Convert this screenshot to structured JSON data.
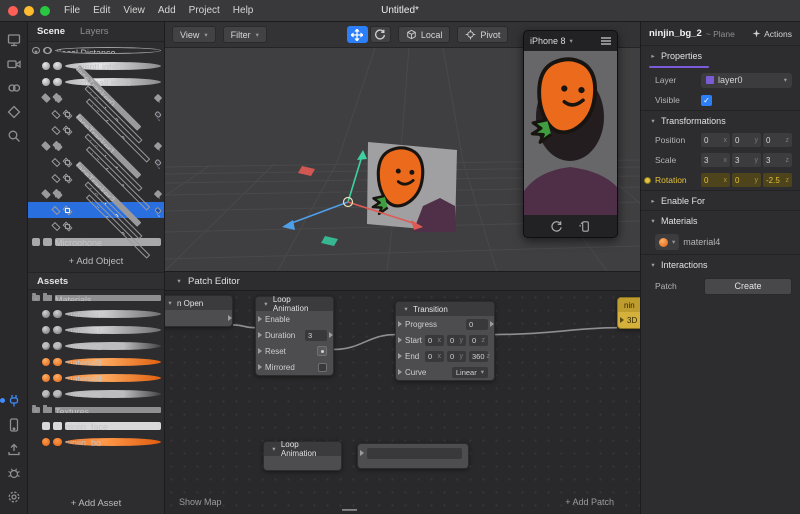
{
  "titlebar": {
    "title": "Untitled*",
    "menus": [
      "File",
      "Edit",
      "View",
      "Add",
      "Project",
      "Help"
    ]
  },
  "left_toolbar": {
    "icons": [
      "display-icon",
      "camera-icon",
      "orbit-icon",
      "mesh-icon",
      "search-icon",
      "plug-icon",
      "device-icon",
      "upload-icon",
      "bug-icon",
      "gear-icon"
    ]
  },
  "scene": {
    "tabs": {
      "scene": "Scene",
      "layers": "Layers"
    },
    "items": [
      {
        "label": "Focal Distance",
        "depth": 0,
        "icon": "focal",
        "expander": true
      },
      {
        "label": "ambientLight0",
        "depth": 1,
        "icon": "light"
      },
      {
        "label": "directionalLight0",
        "depth": 1,
        "icon": "light"
      },
      {
        "label": "faceTracker0",
        "depth": 1,
        "icon": "tracker",
        "expander": true,
        "badge": true
      },
      {
        "label": "ninjin_bg_0",
        "depth": 2,
        "icon": "plane",
        "badge": true
      },
      {
        "label": "ninjin_face_0",
        "depth": 2,
        "icon": "plane"
      },
      {
        "label": "faceTracker1",
        "depth": 1,
        "icon": "tracker",
        "expander": true,
        "badge": true
      },
      {
        "label": "ninjin_bg_1",
        "depth": 2,
        "icon": "plane",
        "badge": true
      },
      {
        "label": "ninjin_face_1",
        "depth": 2,
        "icon": "plane"
      },
      {
        "label": "faceTracker2",
        "depth": 1,
        "icon": "tracker",
        "expander": true,
        "badge": true
      },
      {
        "label": "ninjin_bg_2",
        "depth": 2,
        "icon": "plane",
        "badge": true,
        "selected": true
      },
      {
        "label": "ninjin_face_2",
        "depth": 2,
        "icon": "plane"
      },
      {
        "label": "Microphone",
        "depth": 0,
        "icon": "mic"
      }
    ],
    "add_button": "+ Add Object"
  },
  "assets": {
    "title": "Assets",
    "items": [
      {
        "label": "Materials",
        "depth": 0,
        "icon": "folder",
        "expander": true
      },
      {
        "label": "material0",
        "depth": 1,
        "icon": "sphere-gray"
      },
      {
        "label": "material1",
        "depth": 1,
        "icon": "sphere-gray"
      },
      {
        "label": "material2",
        "depth": 1,
        "icon": "sphere-half"
      },
      {
        "label": "material3",
        "depth": 1,
        "icon": "sphere-orange"
      },
      {
        "label": "material4",
        "depth": 1,
        "icon": "sphere-orange"
      },
      {
        "label": "material5",
        "depth": 1,
        "icon": "sphere-half"
      },
      {
        "label": "Textures",
        "depth": 0,
        "icon": "folder",
        "expander": true
      },
      {
        "label": "ninjin_face",
        "depth": 1,
        "icon": "tex-gray"
      },
      {
        "label": "ninjin_bg",
        "depth": 1,
        "icon": "tex-orange"
      }
    ],
    "add_button": "+ Add Asset"
  },
  "viewport": {
    "view_button": "View",
    "filter_button": "Filter",
    "local_button": "Local",
    "pivot_button": "Pivot",
    "simulator_device": "iPhone 8"
  },
  "patch_editor": {
    "title": "Patch Editor",
    "show_map": "Show Map",
    "add_patch": "+ Add Patch",
    "node_mouth": {
      "title": "n Open"
    },
    "node_loop": {
      "title": "Loop Animation",
      "rows": [
        {
          "label": "Enable",
          "value": ""
        },
        {
          "label": "Duration",
          "value": "3"
        },
        {
          "label": "Reset",
          "value": ""
        },
        {
          "label": "Mirrored",
          "value": ""
        }
      ]
    },
    "node_transition": {
      "title": "Transition",
      "labels": {
        "progress": "Progress",
        "start": "Start",
        "end": "End",
        "curve": "Curve"
      },
      "progress_value": "0",
      "start": [
        {
          "v": "0",
          "s": "x"
        },
        {
          "v": "0",
          "s": "y"
        },
        {
          "v": "0",
          "s": "z"
        }
      ],
      "end": [
        {
          "v": "0",
          "s": "x"
        },
        {
          "v": "0",
          "s": "y"
        },
        {
          "v": "360",
          "s": "z"
        }
      ],
      "curve_value": "Linear"
    },
    "node_target": {
      "title": "nin",
      "row": "3D"
    },
    "node_loop2": {
      "title": "Loop Animation"
    }
  },
  "inspector": {
    "title": "ninjin_bg_2",
    "subtitle": "~ Plane",
    "actions_button": "Actions",
    "properties": {
      "header": "Properties",
      "layer_label": "Layer",
      "layer_value": "layer0",
      "visible_label": "Visible"
    },
    "transformations": {
      "header": "Transformations",
      "position_label": "Position",
      "position": [
        {
          "v": "0",
          "s": "x"
        },
        {
          "v": "0",
          "s": "y"
        },
        {
          "v": "0",
          "s": "z"
        }
      ],
      "scale_label": "Scale",
      "scale": [
        {
          "v": "3",
          "s": "x"
        },
        {
          "v": "3",
          "s": "y"
        },
        {
          "v": "3",
          "s": "z"
        }
      ],
      "rotation_label": "Rotation",
      "rotation": [
        {
          "v": "0",
          "s": "x"
        },
        {
          "v": "0",
          "s": "y"
        },
        {
          "v": "-2.5",
          "s": "z"
        }
      ]
    },
    "enable_for": {
      "header": "Enable For"
    },
    "materials": {
      "header": "Materials",
      "value": "material4"
    },
    "interactions": {
      "header": "Interactions",
      "patch_label": "Patch",
      "create_button": "Create"
    }
  },
  "colors": {
    "accent_blue": "#2d7ff9",
    "selection_blue": "#2a6fe0",
    "rotation_yellow": "#e3c23c",
    "node_yellow": "#d4b13c",
    "carrot_orange": "#ec6a1c"
  }
}
